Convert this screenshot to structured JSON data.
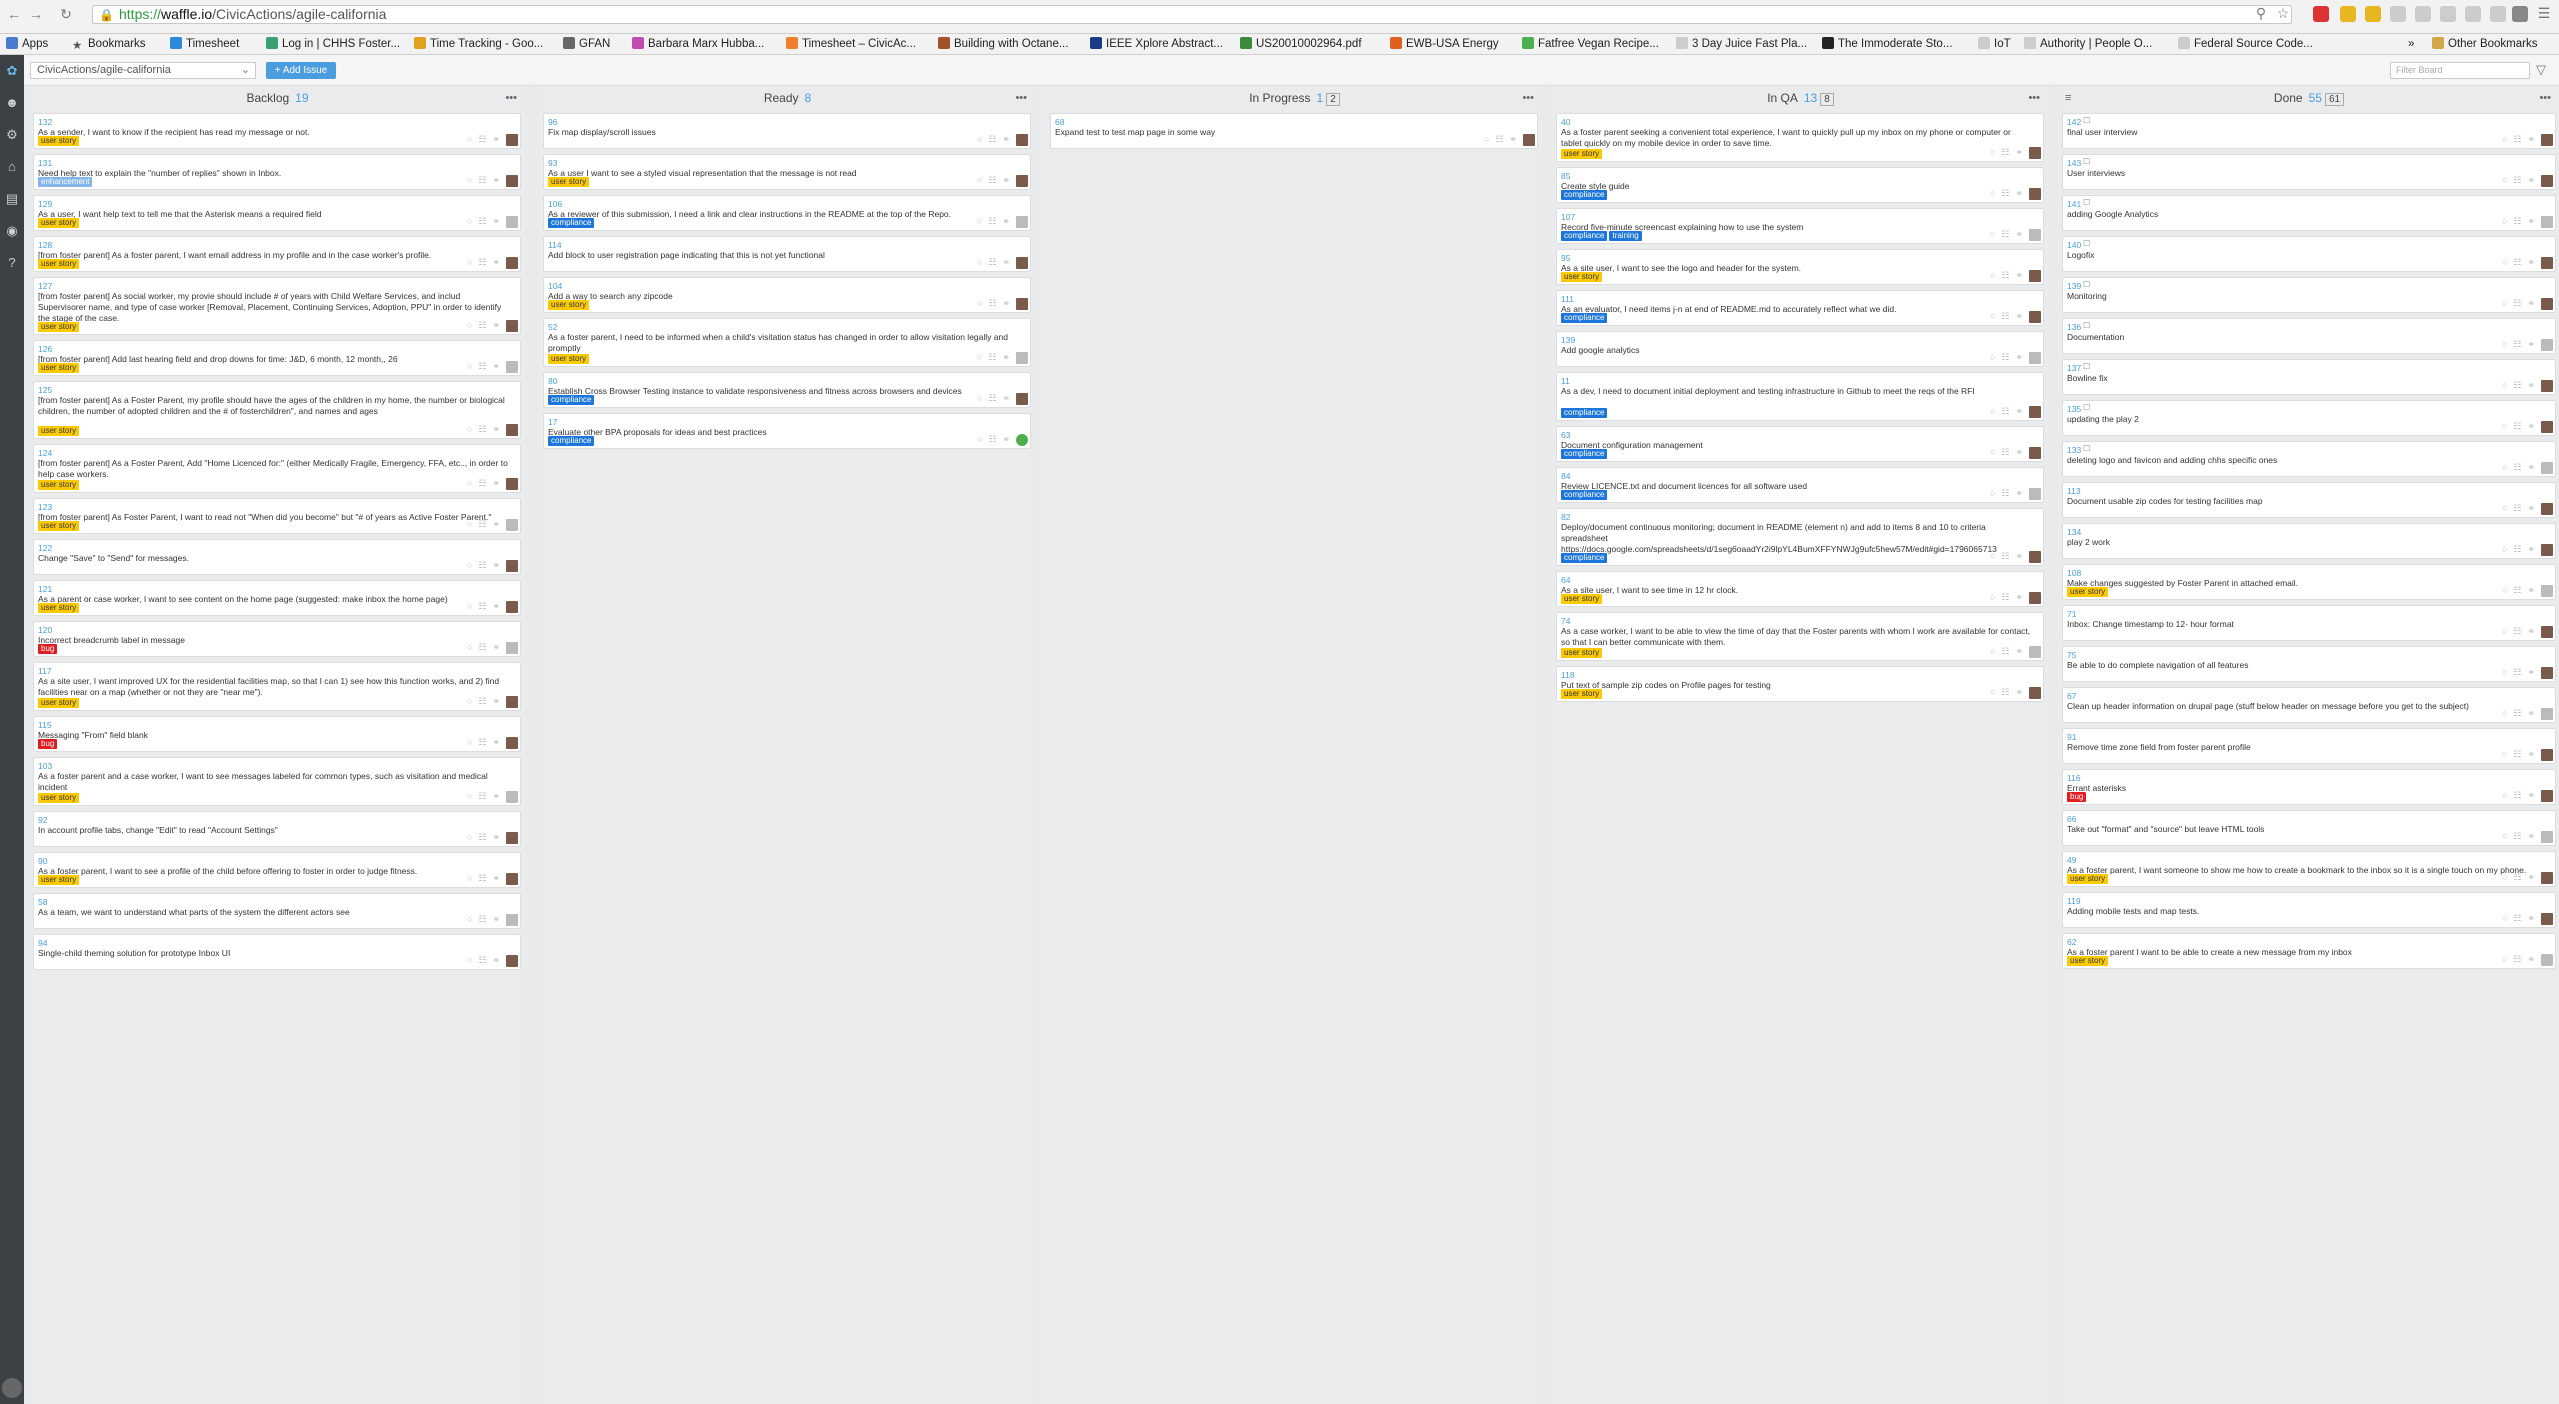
{
  "browser": {
    "url_scheme": "https://",
    "url_host": "waffle.io",
    "url_path": "/CivicActions/agile-california",
    "bookmarks": [
      "Apps",
      "Bookmarks",
      "Timesheet",
      "Log in | CHHS Foster...",
      "Time Tracking - Goo...",
      "GFAN",
      "Barbara Marx Hubba...",
      "Timesheet – CivicAc...",
      "Building with Octane...",
      "IEEE Xplore Abstract...",
      "US20010002964.pdf",
      "EWB-USA Energy",
      "Fatfree Vegan Recipe...",
      "3 Day Juice Fast Pla...",
      "The Immoderate Sto...",
      "IoT",
      "Authority | People O...",
      "Federal Source Code..."
    ],
    "other_bookmarks": "Other Bookmarks",
    "overflow": "»"
  },
  "app": {
    "repo": "CivicActions/agile-california",
    "add_issue": "+ Add Issue",
    "filter_placeholder": "Filter Board"
  },
  "columns": [
    {
      "name": "Backlog",
      "count": "19",
      "count2": "",
      "cards": [
        {
          "num": "132",
          "title": "As a sender, I want to know if the recipient has read my message or not.",
          "labels": [
            "user story"
          ],
          "h": 36
        },
        {
          "num": "131",
          "title": "Need help text to explain the \"number of replies\" shown in Inbox.",
          "labels": [
            "enhancement"
          ],
          "h": 36
        },
        {
          "num": "129",
          "title": "As a user, I want help text to tell me that the Asterisk means a required field",
          "labels": [
            "user story"
          ],
          "h": 36
        },
        {
          "num": "128",
          "title": "[from foster parent] As a foster parent, I want email address in my profile and in the case worker's profile.",
          "labels": [
            "user story"
          ],
          "h": 36
        },
        {
          "num": "127",
          "title": "[from foster parent] As social worker, my provie should include # of years with Child Welfare Services, and includ Supervisorer name, and type of case worker [Removal, Placement, Continuing Services, Adoption, PPU\" in order to identify the stage of the case.",
          "labels": [
            "user story"
          ],
          "h": 58
        },
        {
          "num": "126",
          "title": "[from foster parent] Add last hearing field and drop downs for time: J&D, 6 month, 12 month,, 26",
          "labels": [
            "user story"
          ],
          "h": 36
        },
        {
          "num": "125",
          "title": "[from foster parent] As a Foster Parent, my profile should have the ages of the children in my home, the number or biological children, the number of adopted children and the # of fosterchildren\", and names and ages",
          "labels": [
            "user story"
          ],
          "h": 58
        },
        {
          "num": "124",
          "title": "[from foster parent] As a Foster Parent, Add \"Home Licenced for:\" (either Medically Fragile, Emergency, FFA, etc.., in order to help case workers.",
          "labels": [
            "user story"
          ],
          "h": 49
        },
        {
          "num": "123",
          "title": "[from foster parent] As Foster Parent, I want to read not \"When did you become\" but \"# of years as Active Foster Parent.\"",
          "labels": [
            "user story"
          ],
          "h": 36
        },
        {
          "num": "122",
          "title": "Change \"Save\" to \"Send\" for messages.",
          "labels": [],
          "h": 36
        },
        {
          "num": "121",
          "title": "As a parent or case worker, I want to see content on the home page (suggested: make inbox the home page)",
          "labels": [
            "user story"
          ],
          "h": 36
        },
        {
          "num": "120",
          "title": "Incorrect breadcrumb label in message",
          "labels": [
            "bug"
          ],
          "h": 36
        },
        {
          "num": "117",
          "title": "As a site user, I want improved UX for the residential facilities map, so that I can 1) see how this function works, and 2) find facilities near on a map (whether or not they are \"near me\").",
          "labels": [
            "user story"
          ],
          "h": 49
        },
        {
          "num": "115",
          "title": "Messaging \"From\" field blank",
          "labels": [
            "bug"
          ],
          "h": 36
        },
        {
          "num": "103",
          "title": "As a foster parent and a case worker, I want to see messages labeled for common types, such as visitation and medical incident",
          "labels": [
            "user story"
          ],
          "h": 49
        },
        {
          "num": "92",
          "title": "In account profile tabs, change \"Edit\" to read \"Account Settings\"",
          "labels": [],
          "h": 36
        },
        {
          "num": "90",
          "title": "As a foster parent, I want to see a profile of the child before offering to foster in order to judge fitness.",
          "labels": [
            "user story"
          ],
          "h": 36
        },
        {
          "num": "58",
          "title": "As a team, we want to understand what parts of the system the different actors see",
          "labels": [],
          "h": 36
        },
        {
          "num": "94",
          "title": "Single-child theming solution for prototype Inbox UI",
          "labels": [],
          "h": 36
        }
      ]
    },
    {
      "name": "Ready",
      "count": "8",
      "count2": "",
      "cards": [
        {
          "num": "96",
          "title": "Fix map display/scroll issues",
          "labels": [],
          "h": 36
        },
        {
          "num": "93",
          "title": "As a user I want to see a styled visual representation that the message is not read",
          "labels": [
            "user story"
          ],
          "h": 36
        },
        {
          "num": "106",
          "title": "As a reviewer of this submission, I need a link and clear instructions in the README at the top of the Repo.",
          "labels": [
            "compliance"
          ],
          "h": 36
        },
        {
          "num": "114",
          "title": "Add block to user registration page indicating that this is not yet functional",
          "labels": [],
          "h": 36
        },
        {
          "num": "104",
          "title": "Add a way to search any zipcode",
          "labels": [
            "user story"
          ],
          "h": 36
        },
        {
          "num": "52",
          "title": "As a foster parent, I need to be informed when a child's visitation status has changed in order to allow visitation legally and promptly",
          "labels": [
            "user story"
          ],
          "h": 49
        },
        {
          "num": "80",
          "title": "Establish Cross Browser Testing instance to validate responsiveness and fitness across browsers and devices",
          "labels": [
            "compliance"
          ],
          "h": 36
        },
        {
          "num": "17",
          "title": "Evaluate other BPA proposals for ideas and best practices",
          "labels": [
            "compliance"
          ],
          "h": 36
        }
      ]
    },
    {
      "name": "In Progress",
      "count": "1",
      "count2": "2",
      "cards": [
        {
          "num": "68",
          "title": "Expand test to test map page in some way",
          "labels": [],
          "h": 36
        }
      ]
    },
    {
      "name": "In QA",
      "count": "13",
      "count2": "8",
      "cards": [
        {
          "num": "40",
          "title": "As a foster parent seeking a convenient total experience, I want to quickly pull up my inbox on my phone or computer or tablet quickly on my mobile device in order to save time.",
          "labels": [
            "user story"
          ],
          "h": 49
        },
        {
          "num": "85",
          "title": "Create style guide",
          "labels": [
            "compliance"
          ],
          "h": 36
        },
        {
          "num": "107",
          "title": "Record five-minute screencast explaining how to use the system",
          "labels": [
            "compliance",
            "training"
          ],
          "h": 36
        },
        {
          "num": "95",
          "title": "As a site user, I want to see the logo and header for the system.",
          "labels": [
            "user story"
          ],
          "h": 36
        },
        {
          "num": "111",
          "title": "As an evaluator, I need items j-n at end of README.md to accurately reflect what we did.",
          "labels": [
            "compliance"
          ],
          "h": 36
        },
        {
          "num": "139",
          "title": "Add google analytics",
          "labels": [],
          "h": 36
        },
        {
          "num": "11",
          "title": "As a dev, I need to document initial deployment and testing infrastructure in Github to meet the reqs of the RFI",
          "labels": [
            "compliance"
          ],
          "h": 49
        },
        {
          "num": "63",
          "title": "Document configuration management",
          "labels": [
            "compliance"
          ],
          "h": 36
        },
        {
          "num": "84",
          "title": "Review LICENCE.txt and document licences for all software used",
          "labels": [
            "compliance"
          ],
          "h": 36
        },
        {
          "num": "82",
          "title": "Deploy/document continuous monitoring; document in README (element n) and add to items 8 and 10 to criteria spreadsheet https://docs.google.com/spreadsheets/d/1seg6oaadYr2i9lpYL4BumXFFYNWJg9ufc5hew57M/edit#gid=1796065713",
          "labels": [
            "compliance"
          ],
          "h": 58
        },
        {
          "num": "64",
          "title": "As a site user, I want to see time in 12 hr clock.",
          "labels": [
            "user story"
          ],
          "h": 36
        },
        {
          "num": "74",
          "title": "As a case worker, I want to be able to view the time of day that the Foster parents with whom I work are available for contact, so that I can better communicate with them.",
          "labels": [
            "user story"
          ],
          "h": 49
        },
        {
          "num": "118",
          "title": "Put text of sample zip codes on Profile pages for testing",
          "labels": [
            "user story"
          ],
          "h": 36
        }
      ]
    },
    {
      "name": "Done",
      "count": "55",
      "count2": "61",
      "cards": [
        {
          "num": "142",
          "title": "final user interview",
          "labels": [],
          "h": 36
        },
        {
          "num": "143",
          "title": "User interviews",
          "labels": [],
          "h": 36
        },
        {
          "num": "141",
          "title": "adding Google Analytics",
          "labels": [],
          "h": 36
        },
        {
          "num": "140",
          "title": "Logofix",
          "labels": [],
          "h": 36
        },
        {
          "num": "139",
          "title": "Monitoring",
          "labels": [],
          "h": 36
        },
        {
          "num": "136",
          "title": "Documentation",
          "labels": [],
          "h": 36
        },
        {
          "num": "137",
          "title": "Bowline fix",
          "labels": [],
          "h": 36
        },
        {
          "num": "135",
          "title": "updating the play 2",
          "labels": [],
          "h": 36
        },
        {
          "num": "133",
          "title": "deleting logo and favicon and adding chhs specific ones",
          "labels": [],
          "h": 36
        },
        {
          "num": "113",
          "title": "Document usable zip codes for testing facilities map",
          "labels": [],
          "h": 36
        },
        {
          "num": "134",
          "title": "play 2 work",
          "labels": [],
          "h": 36
        },
        {
          "num": "108",
          "title": "Make changes suggested by Foster Parent in attached email.",
          "labels": [
            "user story"
          ],
          "h": 36
        },
        {
          "num": "71",
          "title": "Inbox: Change timestamp to 12- hour format",
          "labels": [],
          "h": 36
        },
        {
          "num": "75",
          "title": "Be able to do complete navigation of all features",
          "labels": [],
          "h": 36
        },
        {
          "num": "67",
          "title": "Clean up header information on drupal page (stuff below header on message before you get to the subject)",
          "labels": [],
          "h": 36
        },
        {
          "num": "91",
          "title": "Remove time zone field from foster parent profile",
          "labels": [],
          "h": 36
        },
        {
          "num": "116",
          "title": "Errant asterisks",
          "labels": [
            "bug"
          ],
          "h": 36
        },
        {
          "num": "66",
          "title": "Take out \"format\" and \"source\" but leave HTML tools",
          "labels": [],
          "h": 36
        },
        {
          "num": "49",
          "title": "As a foster parent, I want someone to show me how to create a bookmark to the inbox so it is a single touch on my phone.",
          "labels": [
            "user story"
          ],
          "h": 36
        },
        {
          "num": "119",
          "title": "Adding mobile tests and map tests.",
          "labels": [],
          "h": 36
        },
        {
          "num": "62",
          "title": "As a foster parent I want to be able to create a new message from my inbox",
          "labels": [
            "user story"
          ],
          "h": 36
        }
      ]
    }
  ]
}
